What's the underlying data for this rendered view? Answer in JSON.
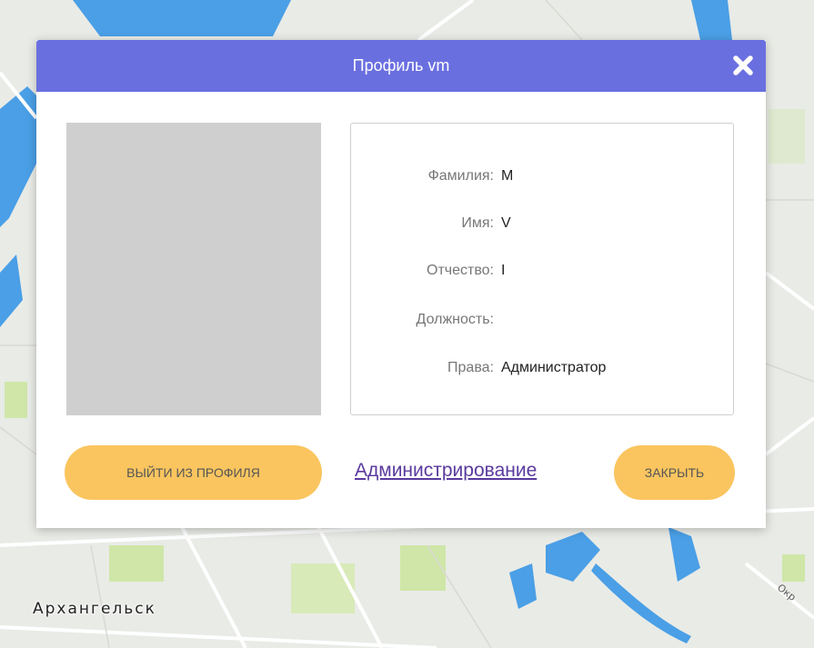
{
  "map": {
    "city_label": "Архангельск",
    "road_label": "Окр",
    "colors": {
      "land": "#e9ebe6",
      "water": "#4a9fe6",
      "green": "#cfe6a8",
      "road": "#ffffff"
    }
  },
  "modal": {
    "title": "Профиль vm",
    "close_icon": "close-x-icon",
    "photo_placeholder": "user-photo",
    "fields": [
      {
        "label": "Фамилия:",
        "value": "M"
      },
      {
        "label": "Имя:",
        "value": "V"
      },
      {
        "label": "Отчество:",
        "value": "I"
      },
      {
        "label": "Должность:",
        "value": ""
      },
      {
        "label": "Права:",
        "value": "Администратор"
      }
    ],
    "logout_button": "ВЫЙТИ ИЗ ПРОФИЛЯ",
    "admin_link": "Администрирование",
    "close_button": "ЗАКРЫТЬ",
    "colors": {
      "header": "#6a6fe0",
      "button": "#fac55f",
      "link": "#5a3a9e",
      "photo": "#cfcfcf"
    }
  }
}
